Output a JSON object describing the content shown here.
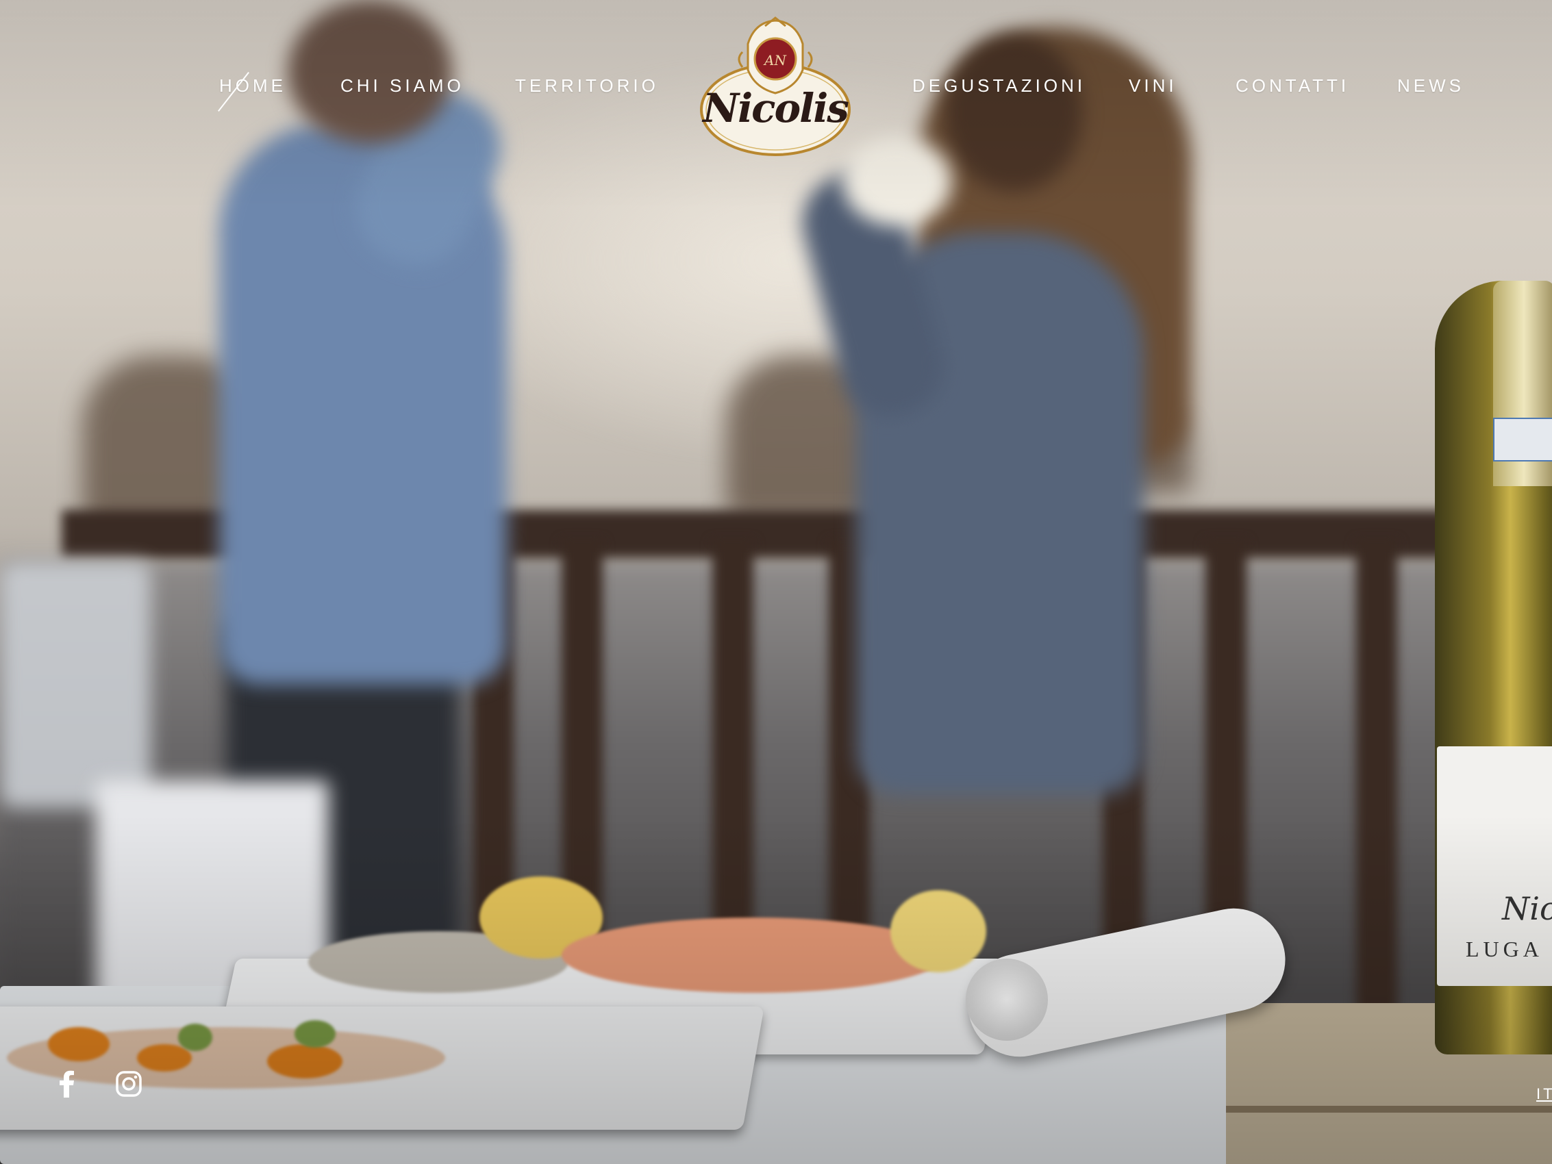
{
  "nav": {
    "left": [
      {
        "label": "HOME",
        "active": true
      },
      {
        "label": "CHI SIAMO"
      },
      {
        "label": "TERRITORIO"
      }
    ],
    "right": [
      {
        "label": "DEGUSTAZIONI"
      },
      {
        "label": "VINI"
      },
      {
        "label": "CONTATTI"
      },
      {
        "label": "NEWS"
      }
    ]
  },
  "logo": {
    "text": "Nicolis",
    "monogram": "AN",
    "colors": {
      "oval": "#f7f2e6",
      "border": "#b8872f",
      "crest": "#8e1c22",
      "text": "#2b1a16"
    }
  },
  "bottle_label": {
    "logo": "Nico",
    "name": "LUGA"
  },
  "social": [
    {
      "icon": "facebook-icon"
    },
    {
      "icon": "instagram-icon"
    }
  ],
  "language": {
    "label": "IT"
  }
}
